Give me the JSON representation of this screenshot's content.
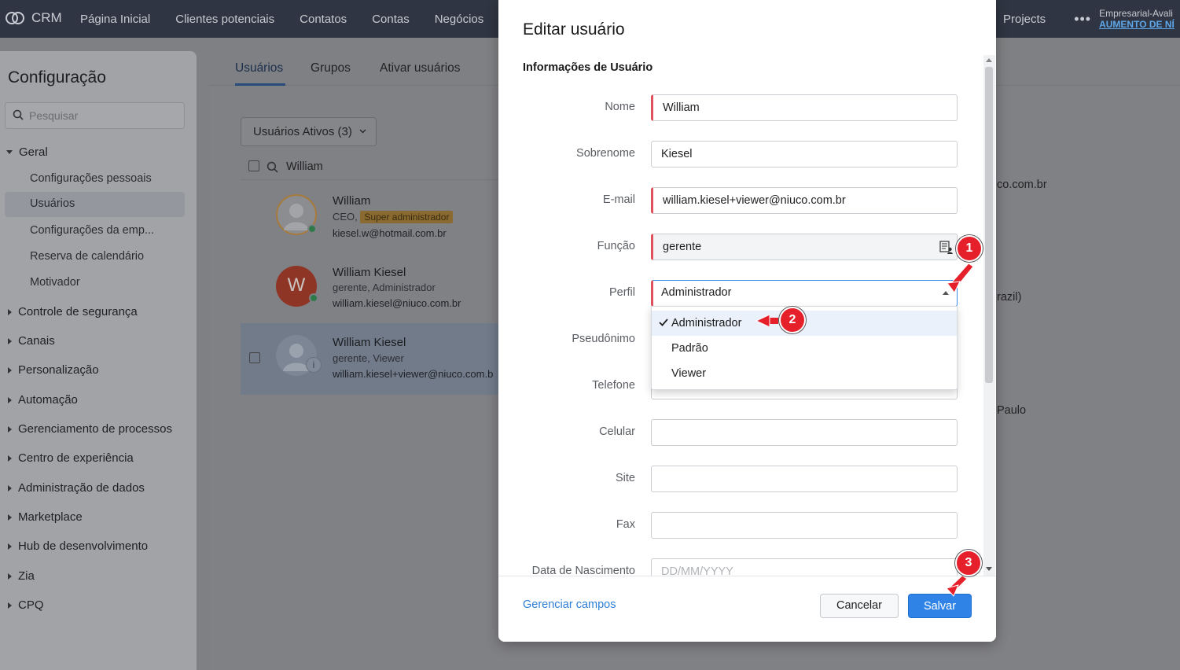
{
  "topbar": {
    "app_name": "CRM",
    "nav": [
      "Página Inicial",
      "Clientes potenciais",
      "Contatos",
      "Contas",
      "Negócios"
    ],
    "projects": "Projects",
    "more": "•••",
    "plan_line1": "Empresarial-Avali",
    "plan_line2": "AUMENTO DE NÍ"
  },
  "sidebar": {
    "title": "Configuração",
    "search_placeholder": "Pesquisar",
    "sections": [
      {
        "label": "Geral",
        "expanded": true
      },
      {
        "label": "Controle de segurança"
      },
      {
        "label": "Canais"
      },
      {
        "label": "Personalização"
      },
      {
        "label": "Automação"
      },
      {
        "label": "Gerenciamento de processos"
      },
      {
        "label": "Centro de experiência"
      },
      {
        "label": "Administração de dados"
      },
      {
        "label": "Marketplace"
      },
      {
        "label": "Hub de desenvolvimento"
      },
      {
        "label": "Zia"
      },
      {
        "label": "CPQ"
      }
    ],
    "geral_items": [
      "Configurações pessoais",
      "Usuários",
      "Configurações da emp...",
      "Reserva de calendário",
      "Motivador"
    ]
  },
  "main": {
    "tabs": [
      "Usuários",
      "Grupos",
      "Ativar usuários"
    ],
    "filter_label": "Usuários Ativos (3)",
    "search_value": "William",
    "users": [
      {
        "name": "William",
        "role": "CEO,",
        "badge": "Super administrador",
        "email": "kiesel.w@hotmail.com.br"
      },
      {
        "name": "William Kiesel",
        "initial": "W",
        "role": "gerente, Administrador",
        "email": "william.kiesel@niuco.com.br"
      },
      {
        "name": "William Kiesel",
        "role": "gerente, Viewer",
        "email": "william.kiesel+viewer@niuco.com.b"
      }
    ],
    "right_fragments": [
      "co.com.br",
      "razil)",
      "Paulo"
    ]
  },
  "modal": {
    "title": "Editar usuário",
    "section": "Informações de Usuário",
    "fields": [
      {
        "label": "Nome",
        "value": "William"
      },
      {
        "label": "Sobrenome",
        "value": "Kiesel"
      },
      {
        "label": "E-mail",
        "value": "william.kiesel+viewer@niuco.com.br"
      },
      {
        "label": "Função",
        "value": "gerente"
      },
      {
        "label": "Perfil",
        "value": "Administrador"
      },
      {
        "label": "Pseudônimo",
        "value": ""
      },
      {
        "label": "Telefone",
        "value": ""
      },
      {
        "label": "Celular",
        "value": ""
      },
      {
        "label": "Site",
        "value": ""
      },
      {
        "label": "Fax",
        "value": ""
      },
      {
        "label": "Data de Nascimento",
        "placeholder": "DD/MM/YYYY"
      }
    ],
    "profile_options": [
      "Administrador",
      "Padrão",
      "Viewer"
    ],
    "manage_fields": "Gerenciar campos",
    "cancel": "Cancelar",
    "save": "Salvar"
  },
  "steps": [
    "1",
    "2",
    "3"
  ],
  "colors": {
    "accent": "#2f83e6",
    "required": "#e0505d",
    "marker": "#e5202a"
  }
}
